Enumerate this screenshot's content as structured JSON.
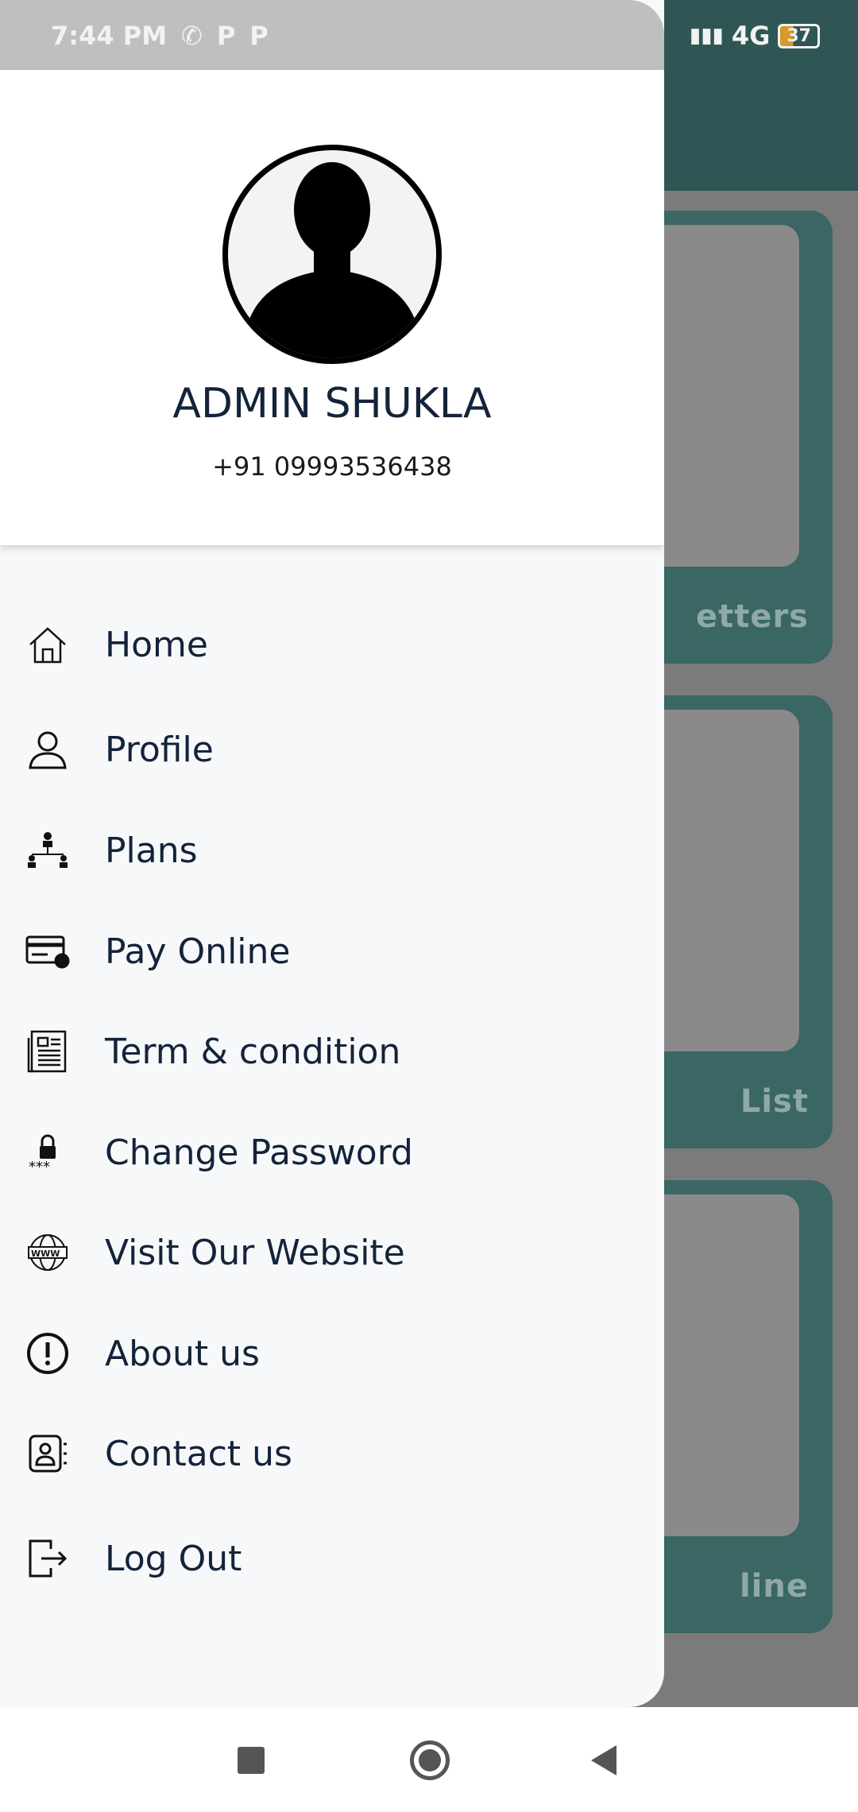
{
  "status_bar": {
    "time": "7:44 PM",
    "network": "4G",
    "battery": "37"
  },
  "background": {
    "cards": [
      {
        "label": "etters"
      },
      {
        "label": "List"
      },
      {
        "label": "line"
      }
    ]
  },
  "drawer": {
    "user_name": "ADMIN SHUKLA",
    "phone": "+91 09993536438",
    "items": [
      {
        "label": "Home",
        "icon": "home-icon"
      },
      {
        "label": "Profile",
        "icon": "user-icon"
      },
      {
        "label": "Plans",
        "icon": "hierarchy-icon"
      },
      {
        "label": "Pay Online",
        "icon": "card-icon"
      },
      {
        "label": "Term & condition",
        "icon": "document-icon"
      },
      {
        "label": "Change Password",
        "icon": "lock-icon"
      },
      {
        "label": "Visit Our Website",
        "icon": "globe-icon"
      },
      {
        "label": "About us",
        "icon": "info-icon"
      },
      {
        "label": "Contact us",
        "icon": "contact-icon"
      },
      {
        "label": "Log Out",
        "icon": "logout-icon"
      }
    ]
  }
}
